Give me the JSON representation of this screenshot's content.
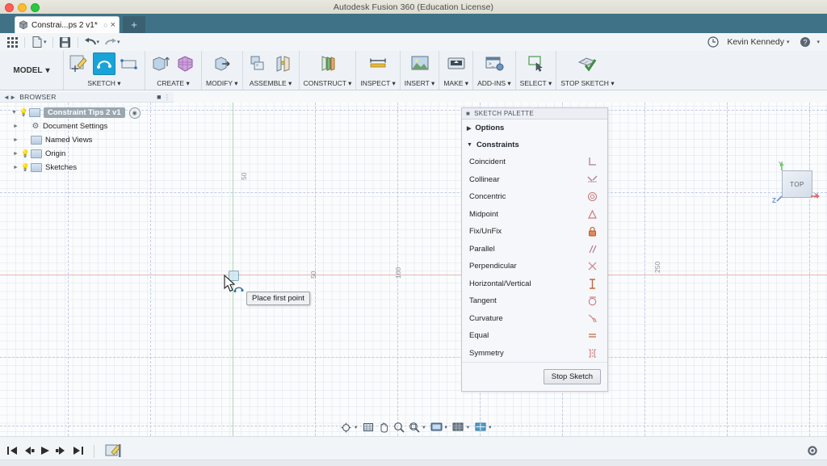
{
  "window": {
    "title": "Autodesk Fusion 360 (Education License)"
  },
  "tab": {
    "label": "Constrai...ps 2 v1*",
    "save_indicator": "○",
    "close": "×",
    "new_tab": "+",
    "icon": "document-cube-icon"
  },
  "quick_access": {
    "grid_icon": "app-grid-icon",
    "new_icon": "new-document-icon",
    "save_icon": "save-icon",
    "undo_icon": "undo-arrow-icon",
    "redo_icon": "redo-arrow-icon",
    "caret": "▾",
    "clock_icon": "recent-clock-icon",
    "user_name": "Kevin Kennedy",
    "user_caret": "▾",
    "help_icon": "help-question-icon",
    "help_caret": "▾"
  },
  "ribbon": {
    "workspace": "MODEL",
    "workspace_caret": "▾",
    "panels": [
      {
        "label": "SKETCH",
        "caret": "▾",
        "icons": [
          "create-sketch-icon",
          "sketch-line-icon",
          "sketch-rectangle-icon"
        ]
      },
      {
        "label": "CREATE",
        "caret": "▾",
        "icons": [
          "extrude-icon",
          "mesh-box-icon"
        ]
      },
      {
        "label": "MODIFY",
        "caret": "▾",
        "icons": [
          "press-pull-icon"
        ]
      },
      {
        "label": "ASSEMBLE",
        "caret": "▾",
        "icons": [
          "new-component-icon",
          "joint-icon"
        ]
      },
      {
        "label": "CONSTRUCT",
        "caret": "▾",
        "icons": [
          "offset-plane-icon"
        ]
      },
      {
        "label": "INSPECT",
        "caret": "▾",
        "icons": [
          "measure-icon"
        ]
      },
      {
        "label": "INSERT",
        "caret": "▾",
        "icons": [
          "insert-image-icon"
        ]
      },
      {
        "label": "MAKE",
        "caret": "▾",
        "icons": [
          "3d-print-icon"
        ]
      },
      {
        "label": "ADD-INS",
        "caret": "▾",
        "icons": [
          "scripts-addins-icon"
        ]
      },
      {
        "label": "SELECT",
        "caret": "▾",
        "icons": [
          "select-window-icon"
        ]
      },
      {
        "label": "STOP SKETCH",
        "caret": "▾",
        "icons": [
          "stop-sketch-check-icon"
        ]
      }
    ]
  },
  "browser": {
    "title": "BROWSER",
    "collapse_icon": "collapse-panel-icon",
    "menu_icon": "panel-menu-icon",
    "root": {
      "label": "Constraint Tips 2 v1",
      "expand_icon": "expanded-triangle-icon",
      "bulb_icon": "lightbulb-icon",
      "doc_icon": "document-icon",
      "eye_icon": "visibility-eye-icon"
    },
    "items": [
      {
        "label": "Document Settings",
        "expand_icon": "collapsed-triangle-icon",
        "lead_icon": "gear-icon",
        "bulb": false
      },
      {
        "label": "Named Views",
        "expand_icon": "collapsed-triangle-icon",
        "lead_icon": "folder-icon",
        "bulb": false
      },
      {
        "label": "Origin",
        "expand_icon": "collapsed-triangle-icon",
        "lead_icon": "folder-icon",
        "bulb": true
      },
      {
        "label": "Sketches",
        "expand_icon": "collapsed-triangle-icon",
        "lead_icon": "folder-icon",
        "bulb": true
      }
    ]
  },
  "canvas": {
    "axis_labels_vertical": [
      "100",
      "50"
    ],
    "axis_labels_horizontal": [
      "50",
      "100"
    ],
    "axis_label_right": "250",
    "tooltip": "Place first point",
    "origin_point": "sketch-origin-point",
    "cursor": "sketch-line-cursor",
    "colors": {
      "x_axis": "#e8b4b4",
      "y_axis": "#a9dca9",
      "grid_major": "#c3cbe8",
      "background": "#fbfcfd"
    }
  },
  "viewcube": {
    "face": "TOP",
    "axis_x": "X",
    "axis_y": "Y",
    "axis_z": "Z",
    "color_x": "#e06767",
    "color_y": "#6fc36f",
    "color_z": "#6a8fd6"
  },
  "palette": {
    "title": "SKETCH PALETTE",
    "grip_icon": "palette-grip-icon",
    "sections": [
      {
        "label": "Options",
        "expanded": false,
        "tri": "▶"
      },
      {
        "label": "Constraints",
        "expanded": true,
        "tri": "▼"
      }
    ],
    "constraints": [
      {
        "label": "Coincident",
        "icon": "coincident-constraint-icon"
      },
      {
        "label": "Collinear",
        "icon": "collinear-constraint-icon"
      },
      {
        "label": "Concentric",
        "icon": "concentric-constraint-icon"
      },
      {
        "label": "Midpoint",
        "icon": "midpoint-constraint-icon"
      },
      {
        "label": "Fix/UnFix",
        "icon": "fix-unfix-lock-icon"
      },
      {
        "label": "Parallel",
        "icon": "parallel-constraint-icon"
      },
      {
        "label": "Perpendicular",
        "icon": "perpendicular-constraint-icon"
      },
      {
        "label": "Horizontal/Vertical",
        "icon": "horizontal-vertical-constraint-icon"
      },
      {
        "label": "Tangent",
        "icon": "tangent-constraint-icon"
      },
      {
        "label": "Curvature",
        "icon": "curvature-constraint-icon"
      },
      {
        "label": "Equal",
        "icon": "equal-constraint-icon"
      },
      {
        "label": "Symmetry",
        "icon": "symmetry-constraint-icon"
      }
    ],
    "stop_sketch": "Stop Sketch"
  },
  "navbar": {
    "items": [
      {
        "icon": "orbit-icon",
        "caret": "▾"
      },
      {
        "icon": "pan-grid-icon",
        "caret": ""
      },
      {
        "icon": "pan-hand-icon",
        "caret": ""
      },
      {
        "icon": "zoom-icon",
        "caret": ""
      },
      {
        "icon": "zoom-window-icon",
        "caret": "▾"
      },
      {
        "icon": "display-settings-icon",
        "caret": "▾"
      },
      {
        "icon": "grid-snaps-icon",
        "caret": "▾"
      },
      {
        "icon": "viewports-icon",
        "caret": "▾"
      }
    ]
  },
  "timeline": {
    "controls": [
      {
        "icon": "jump-start-icon",
        "glyph": "⏮"
      },
      {
        "icon": "step-back-icon",
        "glyph": "◀"
      },
      {
        "icon": "play-icon",
        "glyph": "▶"
      },
      {
        "icon": "step-forward-icon",
        "glyph": "▶"
      },
      {
        "icon": "jump-end-icon",
        "glyph": "⏭"
      }
    ],
    "sketch_feature_icon": "timeline-sketch-feature-icon",
    "settings_icon": "timeline-settings-gear-icon"
  }
}
